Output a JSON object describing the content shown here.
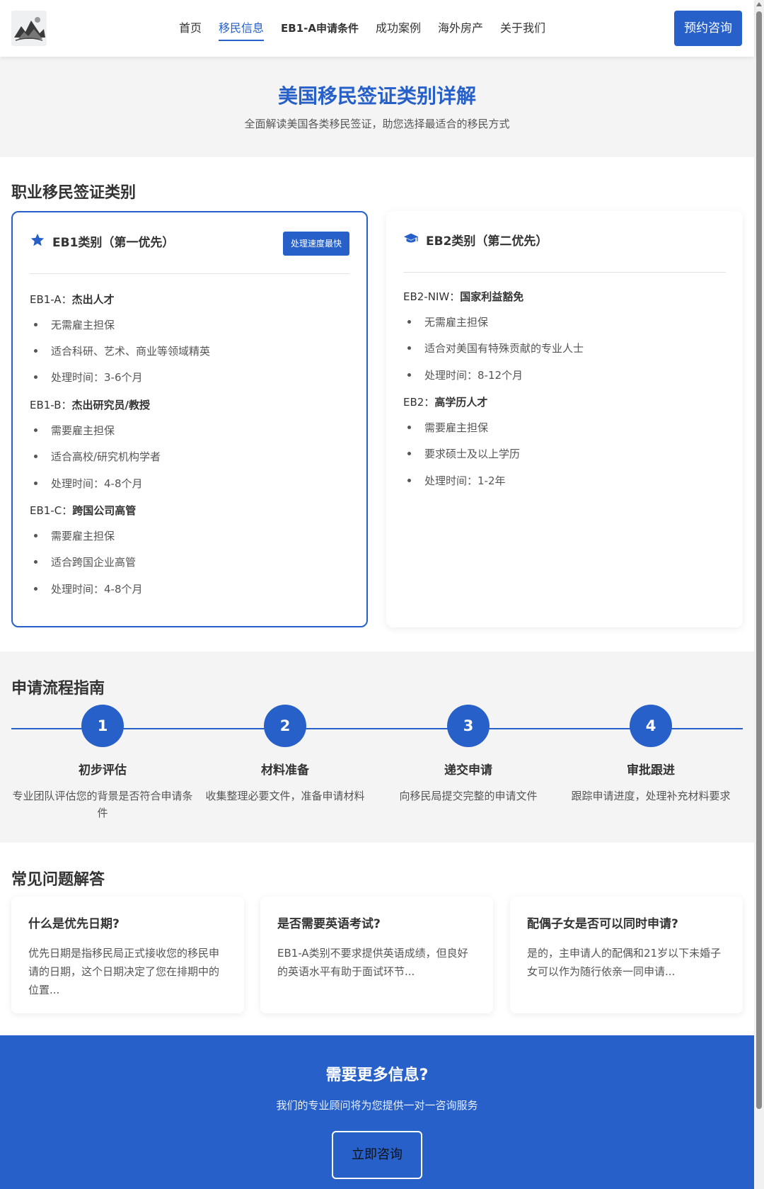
{
  "header": {
    "nav": [
      "首页",
      "移民信息",
      "EB1-A申请条件",
      "成功案例",
      "海外房产",
      "关于我们"
    ],
    "active_index": 1,
    "cta_label": "预约咨询"
  },
  "hero": {
    "title": "美国移民签证类别详解",
    "subtitle": "全面解读美国各类移民签证，助您选择最适合的移民方式"
  },
  "categories": {
    "title": "职业移民签证类别",
    "eb1": {
      "title": "EB1类别（第一优先）",
      "icon": "star-icon",
      "badge": "处理速度最快",
      "groups": [
        {
          "code": "EB1-A：",
          "name": "杰出人才",
          "items": [
            "无需雇主担保",
            "适合科研、艺术、商业等领域精英",
            "处理时间：3-6个月"
          ]
        },
        {
          "code": "EB1-B：",
          "name": "杰出研究员/教授",
          "items": [
            "需要雇主担保",
            "适合高校/研究机构学者",
            "处理时间：4-8个月"
          ]
        },
        {
          "code": "EB1-C：",
          "name": "跨国公司高管",
          "items": [
            "需要雇主担保",
            "适合跨国企业高管",
            "处理时间：4-8个月"
          ]
        }
      ]
    },
    "eb2": {
      "title": "EB2类别（第二优先）",
      "icon": "graduation-cap-icon",
      "groups": [
        {
          "code": "EB2-NIW：",
          "name": "国家利益豁免",
          "items": [
            "无需雇主担保",
            "适合对美国有特殊贡献的专业人士",
            "处理时间：8-12个月"
          ]
        },
        {
          "code": "EB2：",
          "name": "高学历人才",
          "items": [
            "需要雇主担保",
            "要求硕士及以上学历",
            "处理时间：1-2年"
          ]
        }
      ]
    }
  },
  "process": {
    "title": "申请流程指南",
    "steps": [
      {
        "num": "1",
        "title": "初步评估",
        "desc": "专业团队评估您的背景是否符合申请条件"
      },
      {
        "num": "2",
        "title": "材料准备",
        "desc": "收集整理必要文件，准备申请材料"
      },
      {
        "num": "3",
        "title": "递交申请",
        "desc": "向移民局提交完整的申请文件"
      },
      {
        "num": "4",
        "title": "审批跟进",
        "desc": "跟踪申请进度，处理补充材料要求"
      }
    ]
  },
  "faq": {
    "title": "常见问题解答",
    "items": [
      {
        "q": "什么是优先日期?",
        "a": "优先日期是指移民局正式接收您的移民申请的日期，这个日期决定了您在排期中的位置..."
      },
      {
        "q": "是否需要英语考试?",
        "a": "EB1-A类别不要求提供英语成绩，但良好的英语水平有助于面试环节..."
      },
      {
        "q": "配偶子女是否可以同时申请?",
        "a": "是的，主申请人的配偶和21岁以下未婚子女可以作为随行依亲一同申请..."
      }
    ]
  },
  "cta": {
    "title": "需要更多信息?",
    "subtitle": "我们的专业顾问将为您提供一对一咨询服务",
    "button": "立即咨询"
  },
  "colors": {
    "primary": "#2660c8",
    "section_bg": "#f4f4f4"
  }
}
